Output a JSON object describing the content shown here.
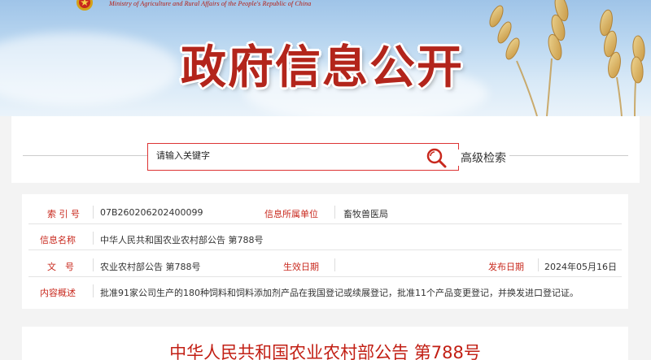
{
  "header": {
    "ministry_en": "Ministry of Agriculture and Rural Affairs of the People's Republic of China",
    "banner_title": "政府信息公开"
  },
  "search": {
    "placeholder": "请输入关键字",
    "advanced_label": "高级检索"
  },
  "info": {
    "index_label": "索 引 号",
    "index_value": "07B260206202400099",
    "unit_label": "信息所属单位",
    "unit_value": "畜牧兽医局",
    "name_label": "信息名称",
    "name_value": "中华人民共和国农业农村部公告 第788号",
    "doc_label": "文　号",
    "doc_value": "农业农村部公告 第788号",
    "effective_label": "生效日期",
    "effective_value": "",
    "publish_label": "发布日期",
    "publish_value": "2024年05月16日",
    "summary_label": "内容概述",
    "summary_value": "批准91家公司生产的180种饲料和饲料添加剂产品在我国登记或续展登记，批准11个产品变更登记，并换发进口登记证。"
  },
  "article": {
    "title": "中华人民共和国农业农村部公告 第788号"
  },
  "colors": {
    "accent_red": "#c8281d",
    "title_red": "#b3251b"
  }
}
